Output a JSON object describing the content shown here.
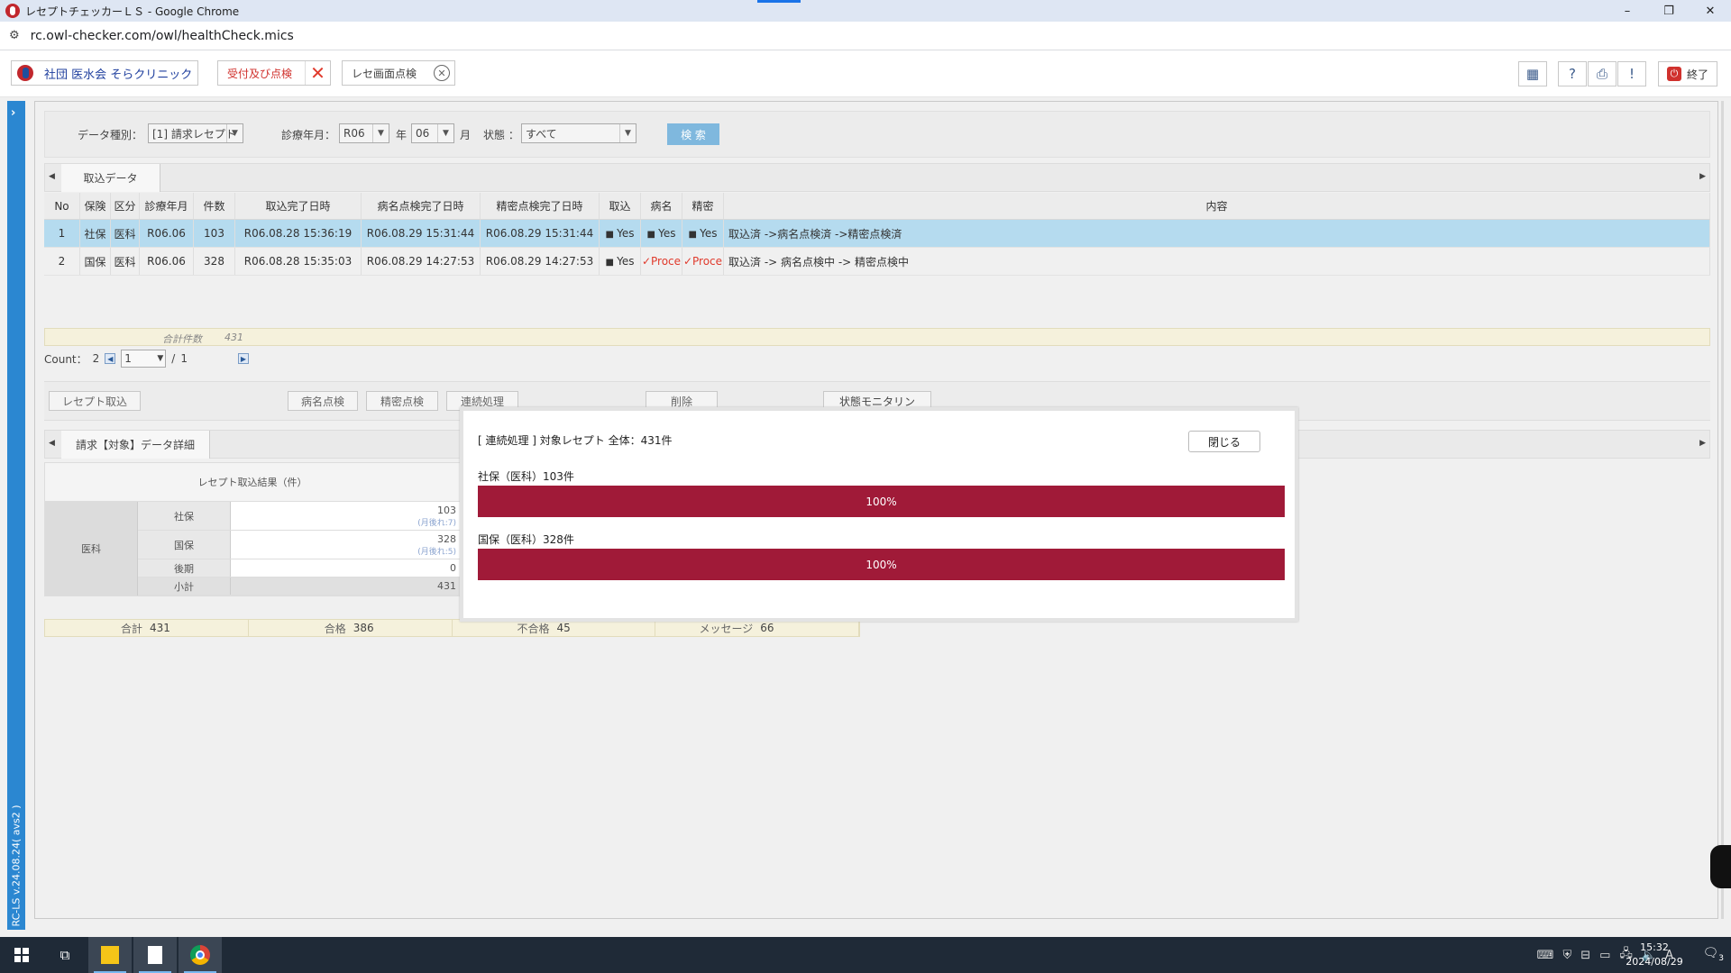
{
  "browser": {
    "title": "レセプトチェッカーＬＳ - Google Chrome",
    "url": "rc.owl-checker.com/owl/healthCheck.mics",
    "window_buttons": [
      "–",
      "❐",
      "✕"
    ]
  },
  "toolbar": {
    "clinic_label": "社団 医水会 そらクリニック",
    "receive_check_label": "受付及び点検",
    "rese_check_label": "レセ画面点検",
    "exit_label": "終了"
  },
  "sidebar": {
    "version": "RC-LS v.24.08.24( avs2 )"
  },
  "filter": {
    "data_type_label": "データ種別：",
    "data_type_value": "[1] 請求レセプト",
    "month_label": "診療年月：",
    "era_value": "R06",
    "year_suffix": "年",
    "month_value": "06",
    "month_suffix": "月",
    "status_label": "状態 ：",
    "status_value": "すべて",
    "search_label": "検 索"
  },
  "import_tab": {
    "label": "取込データ"
  },
  "grid": {
    "headers": [
      "No",
      "保険",
      "区分",
      "診療年月",
      "件数",
      "取込完了日時",
      "病名点検完了日時",
      "精密点検完了日時",
      "取込",
      "病名",
      "精密",
      "内容"
    ],
    "rows": [
      [
        "1",
        "社保",
        "医科",
        "R06.06",
        "103",
        "R06.08.28 15:36:19",
        "R06.08.29 15:31:44",
        "R06.08.29 15:31:44",
        "Yes",
        "Yes",
        "Yes",
        "取込済 ->病名点検済 ->精密点検済"
      ],
      [
        "2",
        "国保",
        "医科",
        "R06.06",
        "328",
        "R06.08.28 15:35:03",
        "R06.08.29 14:27:53",
        "R06.08.29 14:27:53",
        "Yes",
        "Proce",
        "Proce",
        "取込済 -> 病名点検中 -> 精密点検中"
      ]
    ],
    "sum_label": "合計件数",
    "sum_value": "431",
    "count_label": "Count：",
    "count_value": "2",
    "page_value": "1",
    "page_sep": "/",
    "page_total": "1"
  },
  "actions": {
    "import_label": "レセプト取込",
    "disease_label": "病名点検",
    "detail_label": "精密点検",
    "continuous_label": "連続処理",
    "delete_label": "削除",
    "monitor_label": "状態モニタリン"
  },
  "detail_tab": {
    "label": "請求【対象】データ詳細"
  },
  "detail": {
    "header": "レセプト取込結果（件）",
    "category": "医科",
    "rows": [
      {
        "name": "社保",
        "value": "103",
        "sub": "(月後れ:7)"
      },
      {
        "name": "国保",
        "value": "328",
        "sub": "(月後れ:5)"
      },
      {
        "name": "後期",
        "value": "0",
        "sub": ""
      },
      {
        "name": "小計",
        "value": "431",
        "sub": ""
      }
    ],
    "totals": [
      {
        "label": "合計",
        "value": "431"
      },
      {
        "label": "合格",
        "value": "386"
      },
      {
        "label": "不合格",
        "value": "45"
      },
      {
        "label": "メッセージ",
        "value": "66"
      }
    ]
  },
  "modal": {
    "title": "[ 連続処理 ] 対象レセプト 全体：431件",
    "close_label": "閉じる",
    "groups": [
      {
        "label": "社保（医科）103件",
        "progress_text": "100%",
        "progress": 1.0
      },
      {
        "label": "国保（医科）328件",
        "progress_text": "100%",
        "progress": 1.0
      }
    ],
    "bar_color": "#a01a38"
  },
  "taskbar": {
    "time": "15:32",
    "date": "2024/08/29",
    "notif_count": "3",
    "ime": "A"
  }
}
